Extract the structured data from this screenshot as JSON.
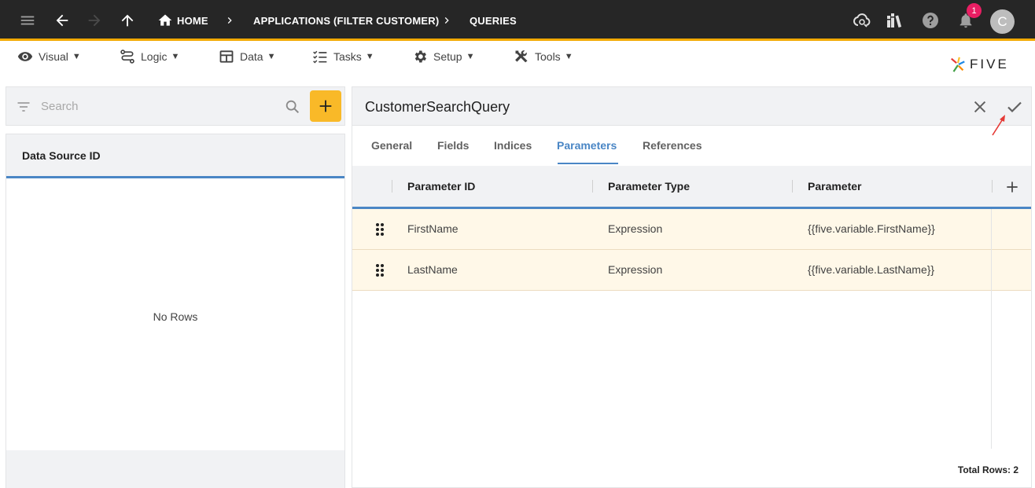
{
  "appbar": {
    "breadcrumbs": [
      "HOME",
      "APPLICATIONS (FILTER CUSTOMER)",
      "QUERIES"
    ],
    "notification_count": "1",
    "avatar_initial": "C"
  },
  "menu": {
    "items": [
      {
        "label": "Visual",
        "icon": "eye-icon"
      },
      {
        "label": "Logic",
        "icon": "logic-icon"
      },
      {
        "label": "Data",
        "icon": "table-icon"
      },
      {
        "label": "Tasks",
        "icon": "tasks-icon"
      },
      {
        "label": "Setup",
        "icon": "gear-icon"
      },
      {
        "label": "Tools",
        "icon": "tools-icon"
      }
    ],
    "caret": "▼",
    "logo_text": "FIVE"
  },
  "left": {
    "search_placeholder": "Search",
    "column_header": "Data Source ID",
    "empty_text": "No Rows"
  },
  "form": {
    "title": "CustomerSearchQuery",
    "tabs": [
      "General",
      "Fields",
      "Indices",
      "Parameters",
      "References"
    ],
    "active_tab": "Parameters",
    "columns": [
      "Parameter ID",
      "Parameter Type",
      "Parameter"
    ],
    "rows": [
      {
        "id": "FirstName",
        "type": "Expression",
        "parameter": "{{five.variable.FirstName}}"
      },
      {
        "id": "LastName",
        "type": "Expression",
        "parameter": "{{five.variable.LastName}}"
      }
    ],
    "total_rows": "Total Rows: 2"
  },
  "colors": {
    "appbar": "#262626",
    "accent_gold": "#f2a900",
    "add_button": "#f9b928",
    "tab_active": "#4a86c5",
    "row_highlight": "#fff8e8",
    "badge": "#e91e63"
  }
}
